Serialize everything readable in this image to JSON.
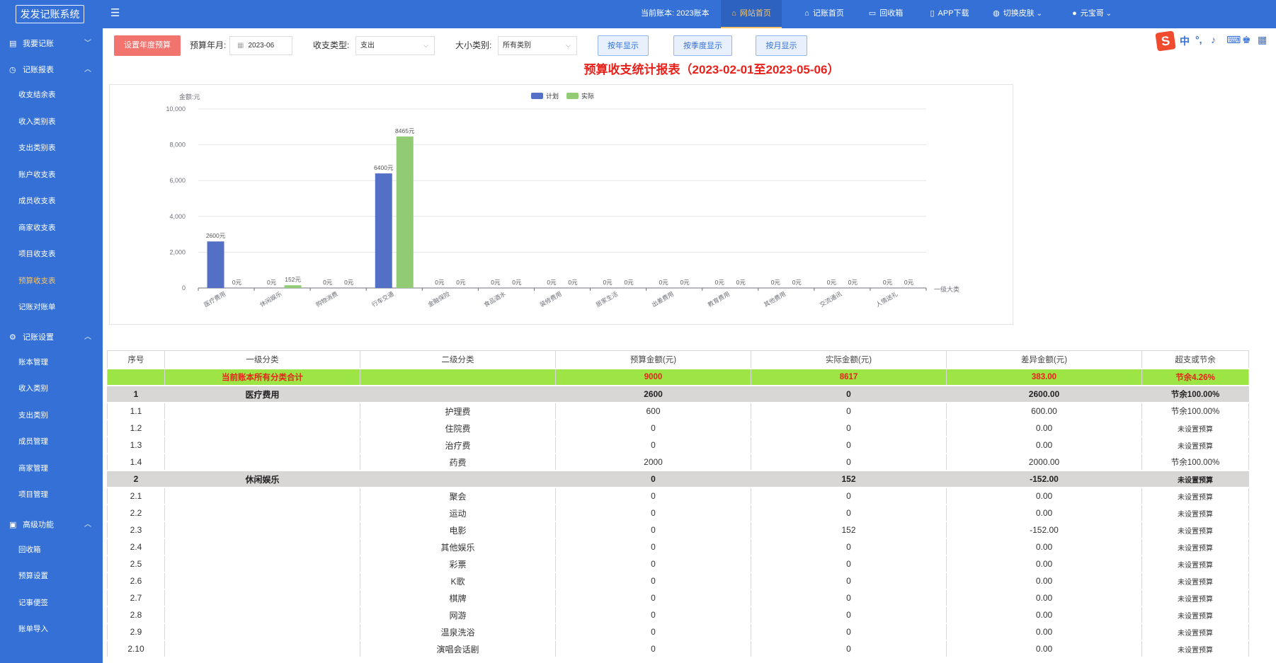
{
  "app": {
    "logo": "发发记账系统"
  },
  "header": {
    "current_book": "当前账本: 2023账本",
    "nav": [
      {
        "label": "网站首页",
        "icon": "home-icon",
        "active": true
      },
      {
        "label": "记账首页",
        "icon": "home-icon",
        "active": false
      },
      {
        "label": "回收箱",
        "icon": "trash-icon",
        "active": false
      },
      {
        "label": "APP下载",
        "icon": "phone-icon",
        "active": false
      },
      {
        "label": "切换皮肤",
        "icon": "palette-icon",
        "active": false
      },
      {
        "label": "元宝哥",
        "icon": "user-icon",
        "active": false
      }
    ]
  },
  "sidebar": {
    "groups": [
      {
        "label": "我要记账",
        "icon": "edit-icon",
        "expanded": false,
        "items": []
      },
      {
        "label": "记账报表",
        "icon": "clock-icon",
        "expanded": true,
        "items": [
          "收支结余表",
          "收入类别表",
          "支出类别表",
          "账户收支表",
          "成员收支表",
          "商家收支表",
          "项目收支表",
          "预算收支表",
          "记账对账单"
        ]
      },
      {
        "label": "记账设置",
        "icon": "gear-icon",
        "expanded": true,
        "items": [
          "账本管理",
          "收入类别",
          "支出类别",
          "成员管理",
          "商家管理",
          "项目管理"
        ]
      },
      {
        "label": "高级功能",
        "icon": "briefcase-icon",
        "expanded": true,
        "items": [
          "回收箱",
          "预算设置",
          "记事便签",
          "账单导入"
        ]
      }
    ],
    "active_item": "预算收支表"
  },
  "toolbar": {
    "set_budget": "设置年度预算",
    "month_label": "预算年月:",
    "month_value": "2023-06",
    "type_label": "收支类型:",
    "type_value": "支出",
    "category_label": "大小类别:",
    "category_value": "所有类别",
    "by_year": "按年显示",
    "by_quarter": "按季度显示",
    "by_month": "按月显示"
  },
  "report": {
    "title": "预算收支统计报表（2023-02-01至2023-05-06）"
  },
  "colors": {
    "brand": "#3470d6",
    "plan": "#5470c6",
    "actual": "#91cc75",
    "total_row": "#9de545",
    "category_row": "#d9d6d6",
    "highlight": "#e8211b"
  },
  "chart_data": {
    "type": "bar",
    "ylabel": "金额:元",
    "xlabel": "一级大类",
    "ylim": [
      0,
      10000
    ],
    "yticks": [
      "10,000",
      "8,000",
      "6,000",
      "4,000",
      "2,000",
      "0"
    ],
    "legend_position": "top",
    "grid": true,
    "categories": [
      "医疗费用",
      "休闲娱乐",
      "购物消费",
      "行车交通",
      "金融保险",
      "食品酒水",
      "装修费用",
      "居家生活",
      "出差费用",
      "教育费用",
      "其他费用",
      "交流通讯",
      "人情送礼"
    ],
    "series": [
      {
        "name": "计划",
        "values": [
          2600,
          0,
          0,
          6400,
          0,
          0,
          0,
          0,
          0,
          0,
          0,
          0,
          0
        ],
        "labels": [
          "2600元",
          "0元",
          "0元",
          "6400元",
          "0元",
          "0元",
          "0元",
          "0元",
          "0元",
          "0元",
          "0元",
          "0元",
          "0元"
        ]
      },
      {
        "name": "实际",
        "values": [
          0,
          152,
          0,
          8465,
          0,
          0,
          0,
          0,
          0,
          0,
          0,
          0,
          0
        ],
        "labels": [
          "0元",
          "152元",
          "0元",
          "8465元",
          "0元",
          "0元",
          "0元",
          "0元",
          "0元",
          "0元",
          "0元",
          "0元",
          "0元"
        ]
      }
    ]
  },
  "table": {
    "headers": [
      "序号",
      "一级分类",
      "二级分类",
      "预算金额(元)",
      "实际金额(元)",
      "差异金额(元)",
      "超支或节余"
    ],
    "rows": [
      {
        "kind": "total",
        "cells": [
          "",
          "当前账本所有分类合计",
          "",
          "9000",
          "8617",
          "383.00",
          "节余4.26%"
        ]
      },
      {
        "kind": "cat",
        "cells": [
          "1",
          "医疗费用",
          "",
          "2600",
          "0",
          "2600.00",
          "节余100.00%"
        ]
      },
      {
        "kind": "sub",
        "cells": [
          "1.1",
          "",
          "护理费",
          "600",
          "0",
          "600.00",
          "节余100.00%"
        ]
      },
      {
        "kind": "sub",
        "cells": [
          "1.2",
          "",
          "住院费",
          "0",
          "0",
          "0.00",
          "未设置预算"
        ]
      },
      {
        "kind": "sub",
        "cells": [
          "1.3",
          "",
          "治疗费",
          "0",
          "0",
          "0.00",
          "未设置预算"
        ]
      },
      {
        "kind": "sub",
        "cells": [
          "1.4",
          "",
          "药费",
          "2000",
          "0",
          "2000.00",
          "节余100.00%"
        ]
      },
      {
        "kind": "cat",
        "cells": [
          "2",
          "休闲娱乐",
          "",
          "0",
          "152",
          "-152.00",
          "未设置预算"
        ]
      },
      {
        "kind": "sub",
        "cells": [
          "2.1",
          "",
          "聚会",
          "0",
          "0",
          "0.00",
          "未设置预算"
        ]
      },
      {
        "kind": "sub",
        "cells": [
          "2.2",
          "",
          "运动",
          "0",
          "0",
          "0.00",
          "未设置预算"
        ]
      },
      {
        "kind": "sub",
        "cells": [
          "2.3",
          "",
          "电影",
          "0",
          "152",
          "-152.00",
          "未设置预算"
        ]
      },
      {
        "kind": "sub",
        "cells": [
          "2.4",
          "",
          "其他娱乐",
          "0",
          "0",
          "0.00",
          "未设置预算"
        ]
      },
      {
        "kind": "sub",
        "cells": [
          "2.5",
          "",
          "彩票",
          "0",
          "0",
          "0.00",
          "未设置预算"
        ]
      },
      {
        "kind": "sub",
        "cells": [
          "2.6",
          "",
          "K歌",
          "0",
          "0",
          "0.00",
          "未设置预算"
        ]
      },
      {
        "kind": "sub",
        "cells": [
          "2.7",
          "",
          "棋牌",
          "0",
          "0",
          "0.00",
          "未设置预算"
        ]
      },
      {
        "kind": "sub",
        "cells": [
          "2.8",
          "",
          "网游",
          "0",
          "0",
          "0.00",
          "未设置预算"
        ]
      },
      {
        "kind": "sub",
        "cells": [
          "2.9",
          "",
          "温泉洗浴",
          "0",
          "0",
          "0.00",
          "未设置预算"
        ]
      },
      {
        "kind": "sub",
        "cells": [
          "2.10",
          "",
          "演唱会话剧",
          "0",
          "0",
          "0.00",
          "未设置预算"
        ]
      }
    ]
  }
}
